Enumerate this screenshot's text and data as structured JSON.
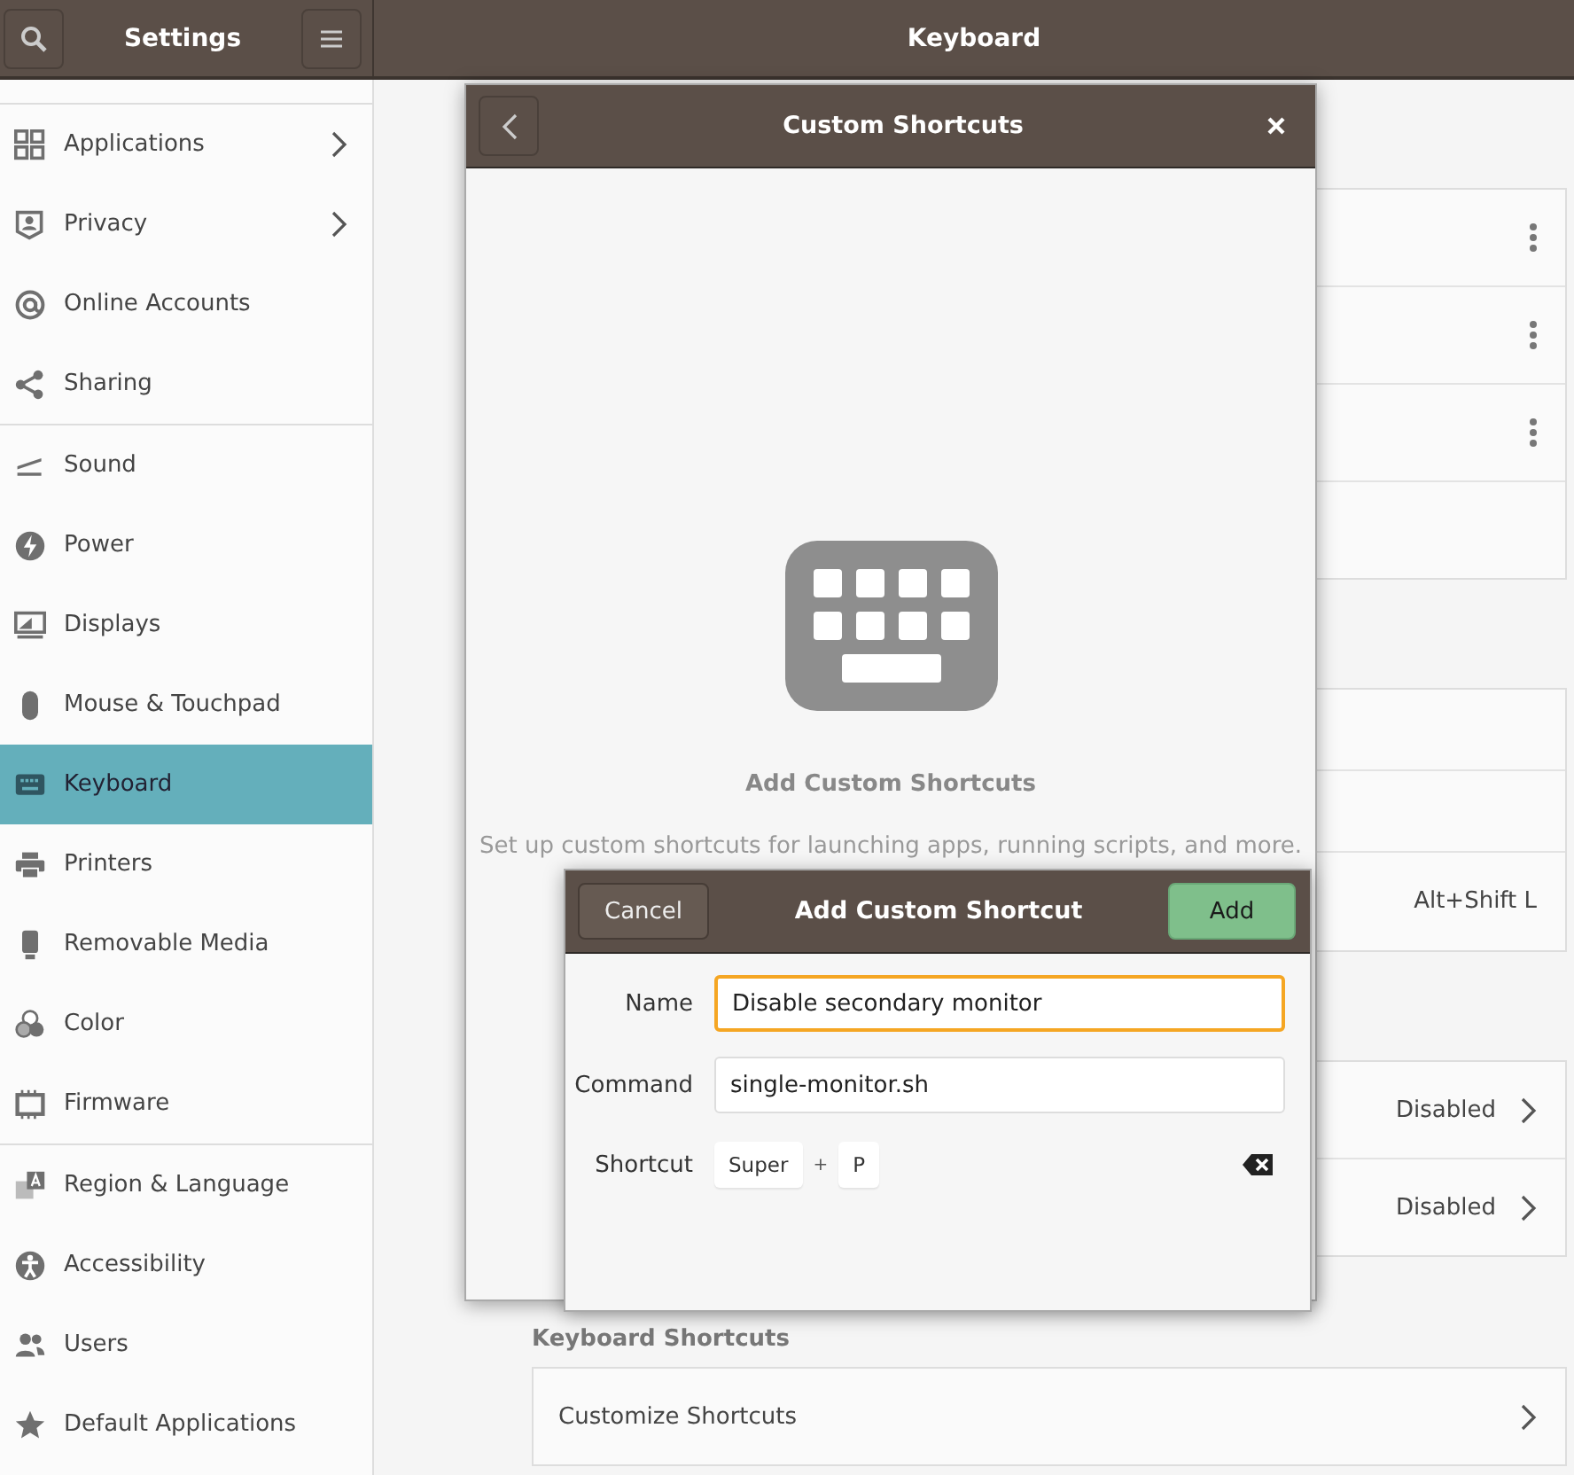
{
  "header": {
    "title": "Settings",
    "page_title": "Keyboard"
  },
  "sidebar": {
    "groups": [
      [
        {
          "label": "Applications",
          "selected": false,
          "has_submenu": true
        },
        {
          "label": "Privacy",
          "selected": false,
          "has_submenu": true
        },
        {
          "label": "Online Accounts",
          "selected": false,
          "has_submenu": false
        },
        {
          "label": "Sharing",
          "selected": false,
          "has_submenu": false
        }
      ],
      [
        {
          "label": "Sound",
          "selected": false,
          "has_submenu": false
        },
        {
          "label": "Power",
          "selected": false,
          "has_submenu": false
        },
        {
          "label": "Displays",
          "selected": false,
          "has_submenu": false
        },
        {
          "label": "Mouse & Touchpad",
          "selected": false,
          "has_submenu": false
        },
        {
          "label": "Keyboard",
          "selected": true,
          "has_submenu": false
        },
        {
          "label": "Printers",
          "selected": false,
          "has_submenu": false
        },
        {
          "label": "Removable Media",
          "selected": false,
          "has_submenu": false
        },
        {
          "label": "Color",
          "selected": false,
          "has_submenu": false
        },
        {
          "label": "Firmware",
          "selected": false,
          "has_submenu": false
        }
      ],
      [
        {
          "label": "Region & Language",
          "selected": false,
          "has_submenu": false
        },
        {
          "label": "Accessibility",
          "selected": false,
          "has_submenu": false
        },
        {
          "label": "Users",
          "selected": false,
          "has_submenu": false
        },
        {
          "label": "Default Applications",
          "selected": false,
          "has_submenu": false
        }
      ]
    ]
  },
  "content": {
    "sections": [
      {
        "rows": [
          {
            "kind": "menu"
          },
          {
            "kind": "menu"
          },
          {
            "kind": "menu"
          },
          {
            "kind": "blank"
          }
        ]
      },
      {
        "rows": [
          {
            "kind": "blank"
          },
          {
            "kind": "blank"
          },
          {
            "kind": "value",
            "value": "Alt+Shift L"
          }
        ]
      },
      {
        "rows": [
          {
            "kind": "link",
            "value": "Disabled"
          },
          {
            "kind": "link",
            "value": "Disabled"
          }
        ]
      },
      {
        "heading": "Keyboard Shortcuts",
        "rows": [
          {
            "kind": "link",
            "label": "Customize Shortcuts"
          }
        ]
      }
    ]
  },
  "custom_shortcuts_dialog": {
    "title": "Custom Shortcuts",
    "empty_title": "Add Custom Shortcuts",
    "empty_description": "Set up custom shortcuts for launching apps, running scripts, and more."
  },
  "add_dialog": {
    "title": "Add Custom Shortcut",
    "cancel": "Cancel",
    "add": "Add",
    "fields": [
      {
        "label": "Name",
        "value": "Disable secondary monitor",
        "focused": true
      },
      {
        "label": "Command",
        "value": "single-monitor.sh",
        "focused": false
      }
    ],
    "shortcut": {
      "label": "Shortcut",
      "keys": [
        "Super",
        "P"
      ],
      "separator": "+"
    }
  }
}
